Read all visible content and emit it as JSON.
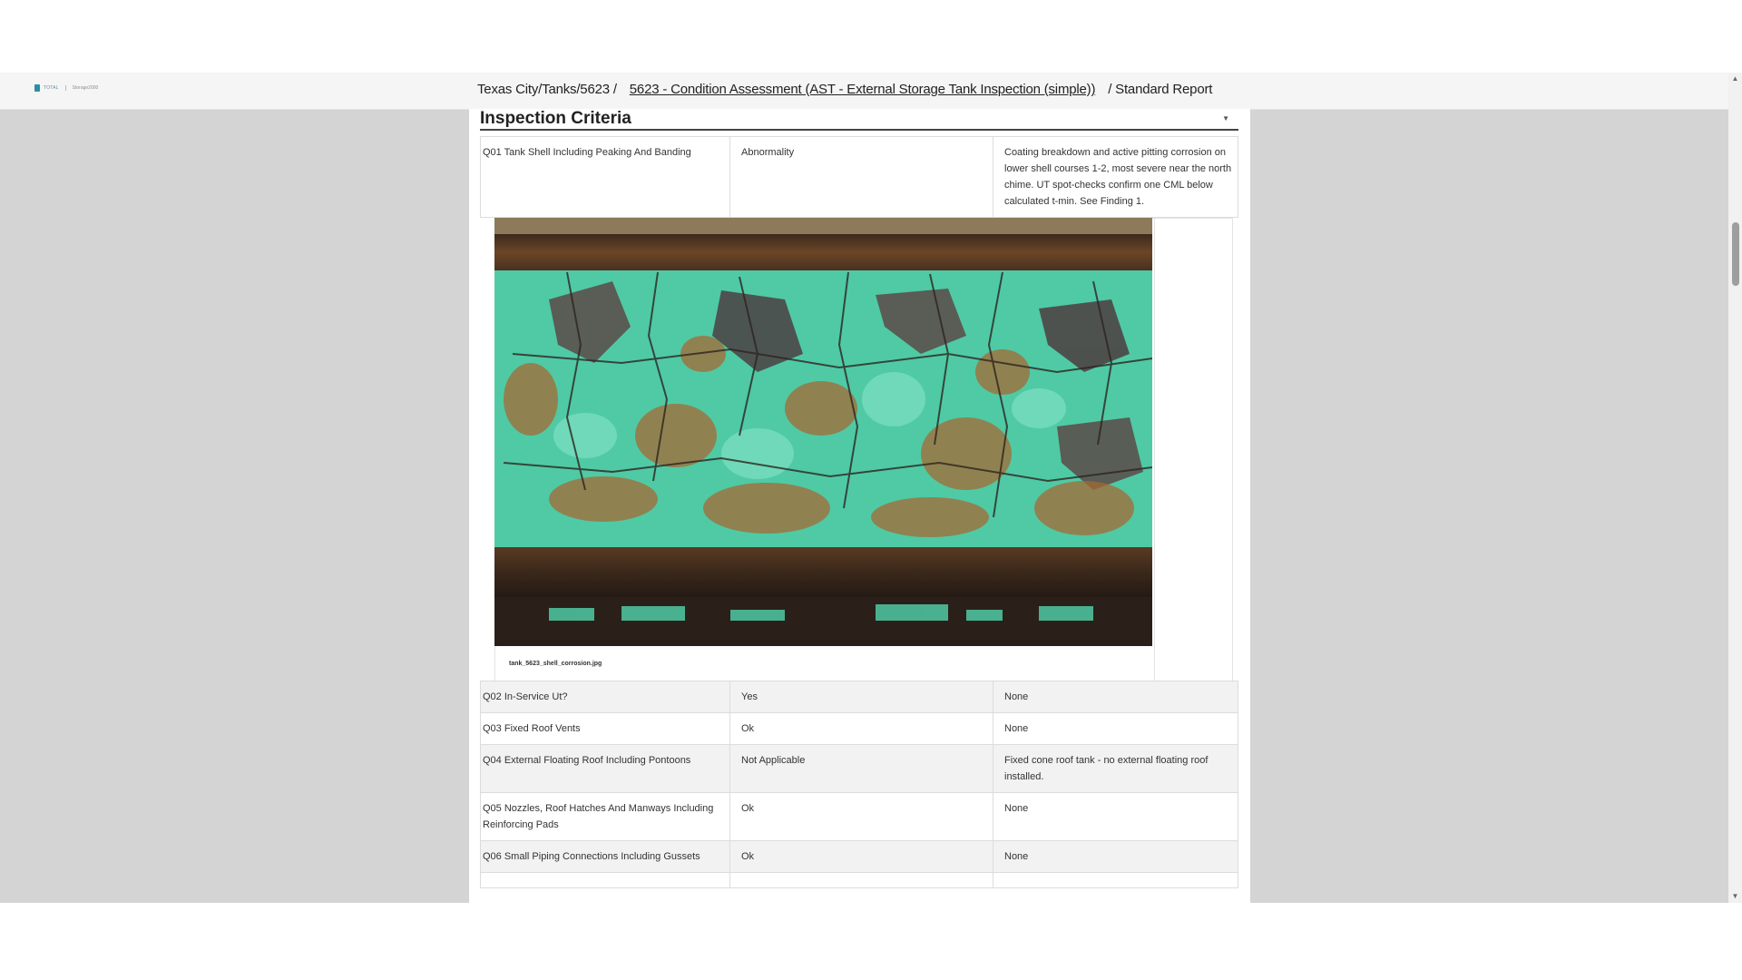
{
  "header": {
    "logo_text": "TOTAL",
    "logo_sub": "Storage2000",
    "breadcrumb_prefix": "Texas City/Tanks/5623 /",
    "breadcrumb_link": "5623 - Condition Assessment (AST - External Storage Tank Inspection (simple))",
    "breadcrumb_suffix": "/ Standard Report"
  },
  "section": {
    "title": "Inspection Criteria",
    "caret": "▼"
  },
  "rows_top": [
    {
      "question": "Q01 Tank Shell Including Peaking And Banding",
      "result": "Abnormality",
      "comment": "Coating breakdown and active pitting corrosion on lower shell courses 1-2, most severe near the north chime. UT spot-checks confirm one CML below calculated t-min. See Finding 1."
    }
  ],
  "photo": {
    "caption": "tank_5623_shell_corrosion.jpg"
  },
  "rows_bottom": [
    {
      "question": "Q02 In-Service Ut?",
      "result": "Yes",
      "comment": "None"
    },
    {
      "question": "Q03 Fixed Roof Vents",
      "result": "Ok",
      "comment": "None"
    },
    {
      "question": "Q04 External Floating Roof Including Pontoons",
      "result": "Not Applicable",
      "comment": "Fixed cone roof tank - no external floating roof installed."
    },
    {
      "question": "Q05 Nozzles, Roof Hatches And Manways Including Reinforcing Pads",
      "result": "Ok",
      "comment": "None"
    },
    {
      "question": "Q06 Small Piping Connections Including Gussets",
      "result": "Ok",
      "comment": "None"
    },
    {
      "question": "",
      "result": "",
      "comment": ""
    }
  ],
  "scrollbar": {
    "up_arrow": "▲",
    "down_arrow": "▼"
  }
}
